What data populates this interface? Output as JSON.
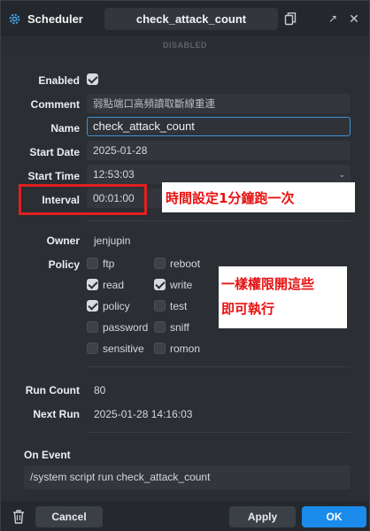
{
  "window": {
    "app_title": "Scheduler",
    "record_title": "check_attack_count",
    "status": "DISABLED"
  },
  "form": {
    "enabled": {
      "label": "Enabled",
      "checked": true
    },
    "comment": {
      "label": "Comment",
      "value": "弱點端口高頻讀取斷線重連"
    },
    "name": {
      "label": "Name",
      "value": "check_attack_count"
    },
    "start_date": {
      "label": "Start Date",
      "value": "2025-01-28"
    },
    "start_time": {
      "label": "Start Time",
      "value": "12:53:03"
    },
    "interval": {
      "label": "Interval",
      "value": "00:01:00"
    },
    "owner": {
      "label": "Owner",
      "value": "jenjupin"
    },
    "policy": {
      "label": "Policy",
      "options": [
        {
          "label": "ftp",
          "checked": false
        },
        {
          "label": "reboot",
          "checked": false
        },
        {
          "label": "read",
          "checked": true
        },
        {
          "label": "write",
          "checked": true
        },
        {
          "label": "policy",
          "checked": true
        },
        {
          "label": "test",
          "checked": false
        },
        {
          "label": "password",
          "checked": false
        },
        {
          "label": "sniff",
          "checked": false
        },
        {
          "label": "sensitive",
          "checked": false
        },
        {
          "label": "romon",
          "checked": false
        }
      ]
    },
    "run_count": {
      "label": "Run Count",
      "value": "80"
    },
    "next_run": {
      "label": "Next Run",
      "value": "2025-01-28 14:16:03"
    },
    "on_event": {
      "label": "On Event",
      "value": "/system script run check_attack_count"
    }
  },
  "annotations": {
    "interval_note": "時間設定1分鐘跑一次",
    "policy_note_line1": "一樣權限開這些",
    "policy_note_line2": "即可執行"
  },
  "footer": {
    "cancel_label": "Cancel",
    "apply_label": "Apply",
    "ok_label": "OK"
  },
  "colors": {
    "accent": "#1a8bea",
    "focus_border": "#3e92d4",
    "annotation_red": "#e02020"
  },
  "icons": {
    "app": "gear-icon",
    "copy": "copy-icon",
    "expand": "expand-icon",
    "close": "close-icon",
    "delete": "trash-icon"
  }
}
